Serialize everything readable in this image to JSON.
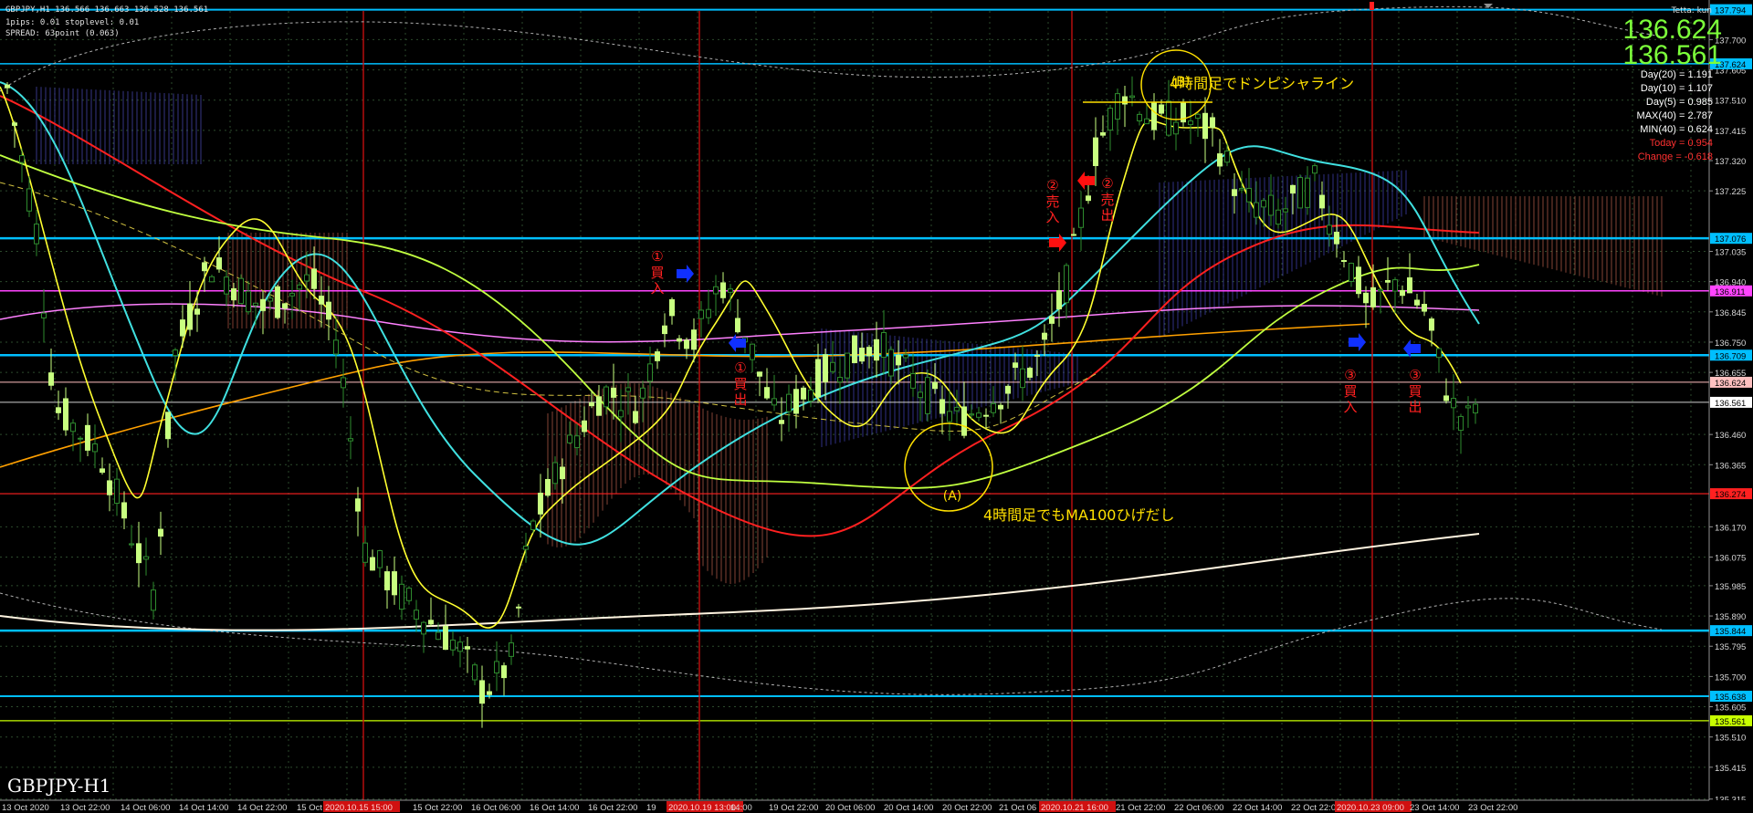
{
  "header": {
    "symbol_info": "GBPJPY,H1  136.566 136.663 136.528 136.561",
    "pips_info": "1pips: 0.01  stoplevel: 0.01",
    "spread_info": "SPREAD: 63point (0.063)",
    "user": "Tetta: kun"
  },
  "prices": {
    "bid": "136.624",
    "ask": "136.561"
  },
  "stats": [
    {
      "text": "Day(20) = 1.191",
      "color": "#ffffff"
    },
    {
      "text": "Day(10) = 1.107",
      "color": "#ffffff"
    },
    {
      "text": "Day(5) = 0.985",
      "color": "#ffffff"
    },
    {
      "text": "MAX(40) = 2.787",
      "color": "#ffffff"
    },
    {
      "text": "MIN(40) = 0.624",
      "color": "#ffffff"
    },
    {
      "text": "Today = 0.954",
      "color": "#ff3030"
    },
    {
      "text": "Change = -0.618",
      "color": "#ff3030"
    }
  ],
  "symbol_label": "GBPJPY-H1",
  "price_axis": {
    "labels": [
      "137.700",
      "137.605",
      "137.510",
      "137.415",
      "137.320",
      "137.225",
      "137.035",
      "136.940",
      "136.845",
      "136.750",
      "136.655",
      "136.460",
      "136.365",
      "136.170",
      "136.075",
      "135.985",
      "135.890",
      "135.795",
      "135.700",
      "135.605",
      "135.510",
      "135.415",
      "135.315"
    ]
  },
  "price_tags": [
    {
      "value": "137.794",
      "color": "#00bfff",
      "text_color": "#000000"
    },
    {
      "value": "137.624",
      "color": "#00bfff",
      "text_color": "#000000"
    },
    {
      "value": "137.076",
      "color": "#00bfff",
      "text_color": "#000000"
    },
    {
      "value": "136.911",
      "color": "#ff44ff",
      "text_color": "#000000"
    },
    {
      "value": "136.709",
      "color": "#00bfff",
      "text_color": "#000000"
    },
    {
      "value": "136.624",
      "color": "#ffc0c0",
      "text_color": "#000000"
    },
    {
      "value": "136.561",
      "color": "#ffffff",
      "text_color": "#000000"
    },
    {
      "value": "136.274",
      "color": "#ff2020",
      "text_color": "#000000"
    },
    {
      "value": "135.844",
      "color": "#00bfff",
      "text_color": "#000000"
    },
    {
      "value": "135.638",
      "color": "#00bfff",
      "text_color": "#000000"
    },
    {
      "value": "135.561",
      "color": "#c8ff00",
      "text_color": "#000000"
    }
  ],
  "time_axis": {
    "labels": [
      {
        "text": "13 Oct 2020",
        "hl": false
      },
      {
        "text": "13 Oct 22:00",
        "hl": false
      },
      {
        "text": "14 Oct 06:00",
        "hl": false
      },
      {
        "text": "14 Oct 14:00",
        "hl": false
      },
      {
        "text": "14 Oct 22:00",
        "hl": false
      },
      {
        "text": "15 Oct",
        "hl": false
      },
      {
        "text": "2020.10.15 15:00",
        "hl": true
      },
      {
        "text": "15 Oct 22:00",
        "hl": false
      },
      {
        "text": "16 Oct 06:00",
        "hl": false
      },
      {
        "text": "16 Oct 14:00",
        "hl": false
      },
      {
        "text": "16 Oct 22:00",
        "hl": false
      },
      {
        "text": "19",
        "hl": false
      },
      {
        "text": "2020.10.19 13:00",
        "hl": true
      },
      {
        "text": "14:00",
        "hl": false
      },
      {
        "text": "19 Oct 22:00",
        "hl": false
      },
      {
        "text": "20 Oct 06:00",
        "hl": false
      },
      {
        "text": "20 Oct 14:00",
        "hl": false
      },
      {
        "text": "20 Oct 22:00",
        "hl": false
      },
      {
        "text": "21 Oct 06",
        "hl": false
      },
      {
        "text": "2020.10.21 16:00",
        "hl": true
      },
      {
        "text": "21 Oct 22:00",
        "hl": false
      },
      {
        "text": "22 Oct 06:00",
        "hl": false
      },
      {
        "text": "22 Oct 14:00",
        "hl": false
      },
      {
        "text": "22 Oct 22:00",
        "hl": false
      },
      {
        "text": "2020.10.23 09:00",
        "hl": true
      },
      {
        "text": "23 Oct 14:00",
        "hl": false
      },
      {
        "text": "23 Oct 22:00",
        "hl": false
      }
    ]
  },
  "annotations": {
    "label_b": "(B)",
    "label_a": "(A)",
    "note_b": "4時間足でドンピシャライン",
    "note_a": "4時間足でもMA100ひげだし",
    "trades": [
      {
        "mark": "①",
        "word": "買入"
      },
      {
        "mark": "①",
        "word": "買出"
      },
      {
        "mark": "②",
        "word": "売入"
      },
      {
        "mark": "②",
        "word": "売出"
      },
      {
        "mark": "③",
        "word": "買入"
      },
      {
        "mark": "③",
        "word": "買出"
      }
    ]
  },
  "colors": {
    "background": "#000000",
    "bull_candle": "#c8ff80",
    "bear_candle": "#2e8b2e",
    "grid": "#2c4a2c",
    "level_line": "#00bfff",
    "annotation": "#ffe000",
    "trade_text": "#ff2020"
  }
}
